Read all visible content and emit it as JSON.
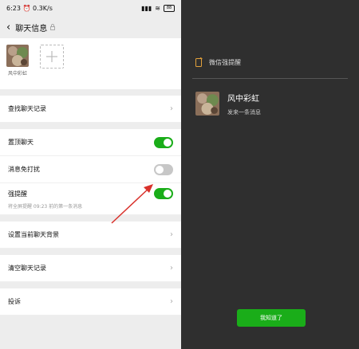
{
  "status_bar": {
    "time": "6:23",
    "speed": "0.3K/s",
    "battery": "88"
  },
  "header": {
    "title": "聊天信息"
  },
  "members": [
    {
      "name": "风中彩虹"
    }
  ],
  "settings": {
    "search_history": "查找聊天记录",
    "pin_chat": {
      "label": "置顶聊天",
      "on": true
    },
    "mute": {
      "label": "消息免打扰",
      "on": false
    },
    "strong_reminder": {
      "label": "强提醒",
      "on": true,
      "hint": "将全屏提醒 09:23 前的第一条消息"
    },
    "set_background": "设置当前聊天背景",
    "clear_history": "清空聊天记录",
    "complain": "投诉"
  },
  "notification": {
    "header": "微信强提醒",
    "sender": "风中彩虹",
    "message": "发来一条消息",
    "button": "我知道了"
  },
  "colors": {
    "accent_green": "#1aad19",
    "dark_bg": "#2f2f2f",
    "light_bg": "#ededed",
    "arrow_red": "#d9312b"
  }
}
